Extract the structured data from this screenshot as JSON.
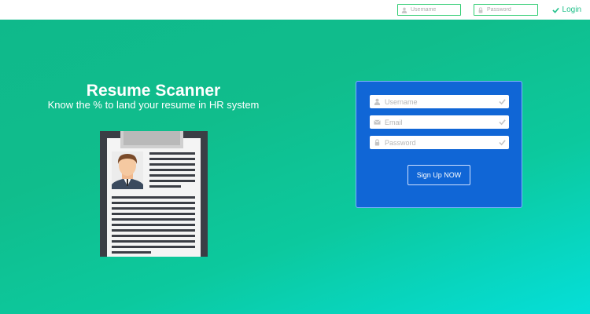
{
  "topbar": {
    "username_placeholder": "Username",
    "password_placeholder": "Password",
    "login_label": "Login"
  },
  "hero": {
    "title": "Resume Scanner",
    "subtitle": "Know the % to land your resume in HR system"
  },
  "signup": {
    "username_placeholder": "Username",
    "email_placeholder": "Email",
    "password_placeholder": "Password",
    "button_label": "Sign Up NOW"
  },
  "icons": {
    "user": "user-icon",
    "lock": "lock-icon",
    "mail": "mail-icon",
    "check": "check-icon",
    "resume": "resume-clipboard-illustration"
  },
  "colors": {
    "accent_green": "#20c08a",
    "panel_blue": "#1066d6",
    "gradient_start": "#0fb98b",
    "gradient_end": "#05dfd9"
  }
}
